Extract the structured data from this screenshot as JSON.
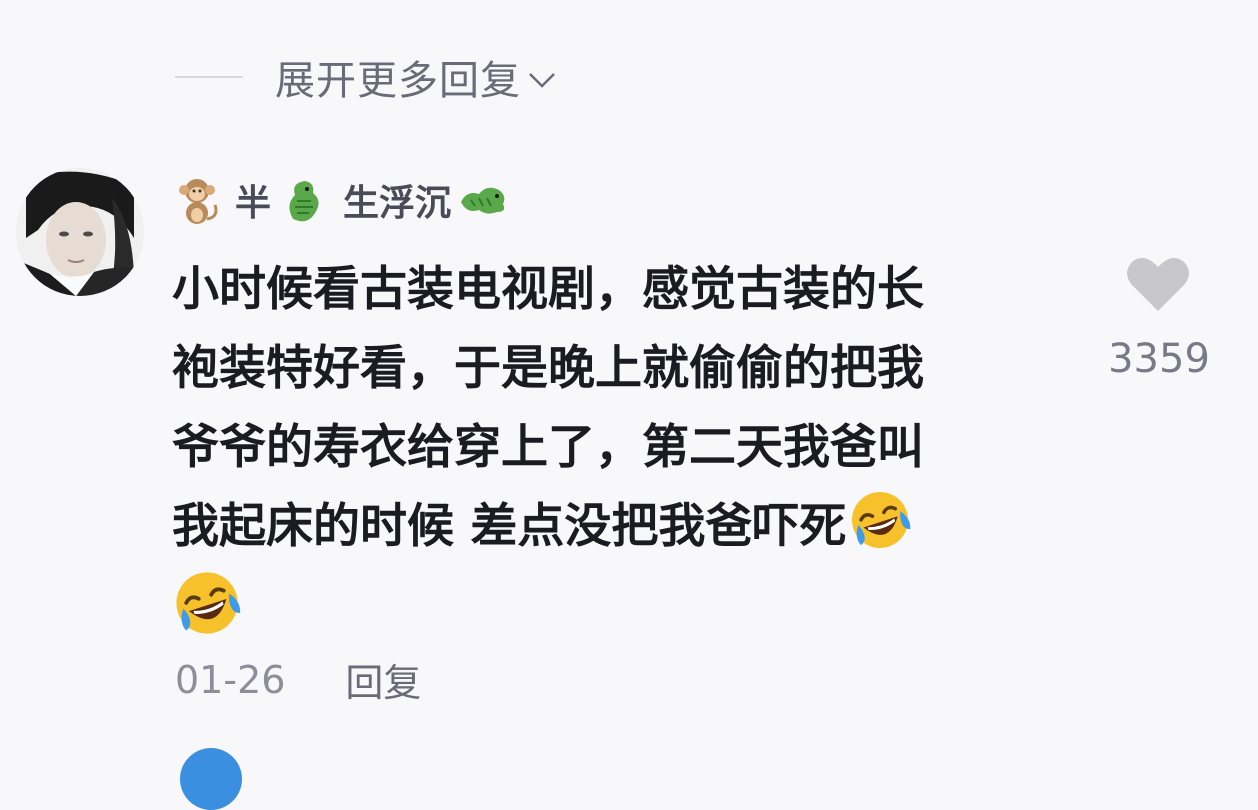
{
  "thread": {
    "expand_replies_label": "展开更多回复",
    "expand_icon": "chevron-down-icon"
  },
  "comment": {
    "username": {
      "part1": "半",
      "part2": "生浮沉",
      "leading_emoji": "monkey-emoji-icon",
      "dragon_emoji_1": "dragon-emoji-icon",
      "dragon_emoji_2": "dragon-emoji-icon"
    },
    "text_lines": [
      "小时候看古装电视剧，感觉古装的长",
      "袍装特好看，于是晚上就偷偷的把我",
      "爷爷的寿衣给穿上了，第二天我爸叫",
      "我起床的时候 差点没把我爸吓死"
    ],
    "trailing_emojis": [
      "laughing-crying-emoji-icon",
      "laughing-crying-emoji-icon"
    ],
    "date": "01-26",
    "reply_label": "回复",
    "like_icon": "heart-icon",
    "like_count": "3359"
  },
  "colors": {
    "background": "#f8f8fa",
    "text_primary": "#1b1b22",
    "text_secondary": "#7a7a86",
    "heart": "#c7c7cc",
    "next_avatar": "#3a8fe0"
  }
}
